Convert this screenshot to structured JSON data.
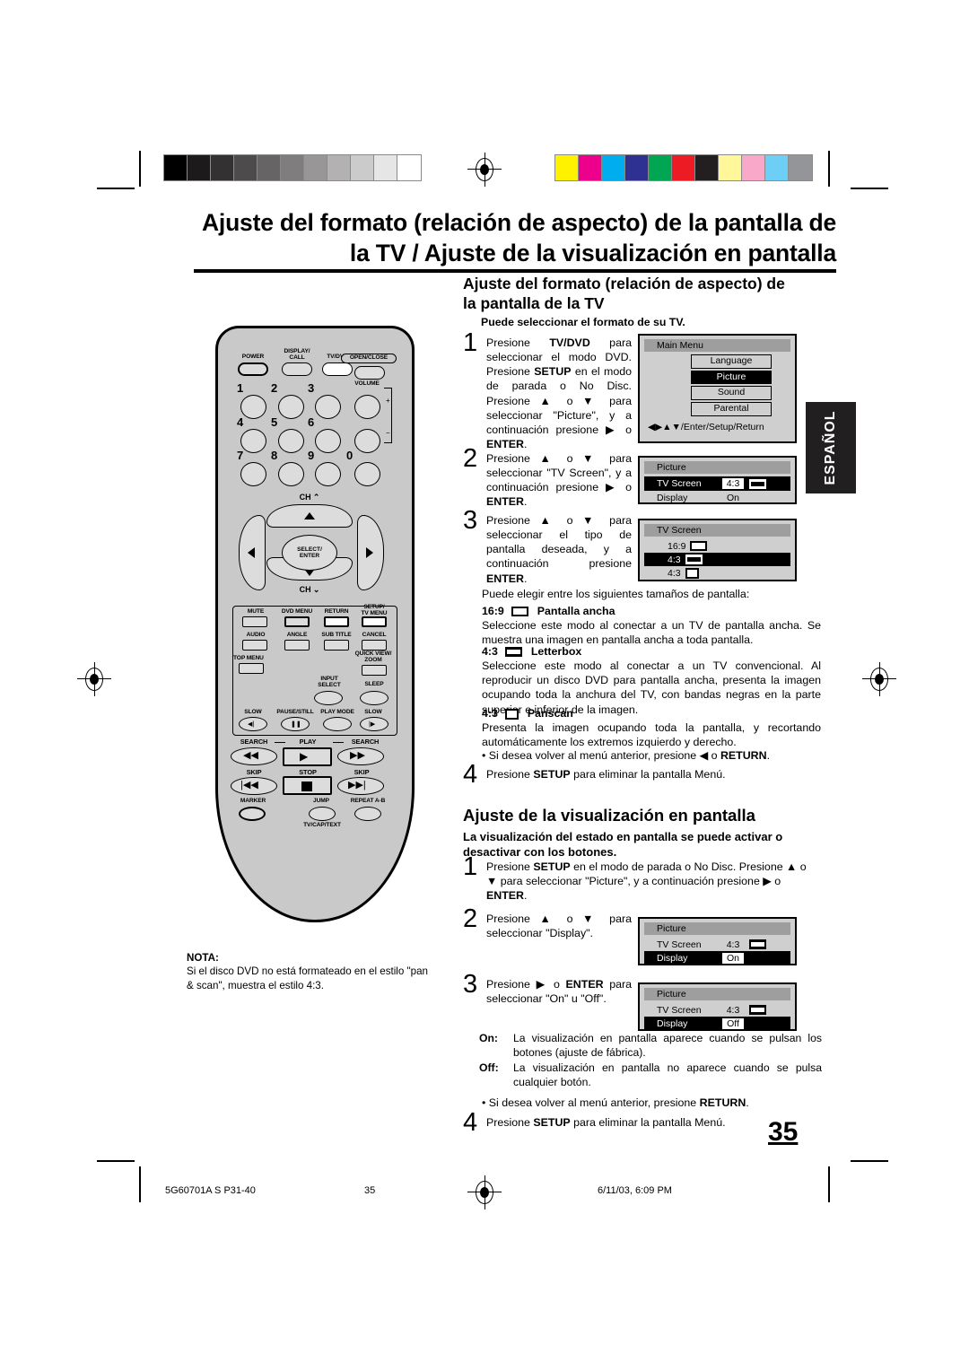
{
  "page": {
    "number": "35",
    "main_title_line1": "Ajuste del formato (relación de aspecto) de la pantalla de",
    "main_title_line2": "la TV / Ajuste de la visualización en pantalla",
    "language_tab": "ESPAÑOL"
  },
  "section1": {
    "title_line1": "Ajuste del formato (relación de aspecto) de",
    "title_line2": "la pantalla de la TV",
    "lead": "Puede seleccionar el formato de su TV.",
    "steps": [
      {
        "num": "1",
        "html": "Presione <b>TV/DVD</b> para seleccionar el modo DVD. Presione <b>SETUP</b> en el modo de parada o No Disc. Presione ▲ o ▼ para seleccionar \"Picture\", y a continuación presione ▶ o <b>ENTER</b>."
      },
      {
        "num": "2",
        "html": "Presione ▲ o ▼ para seleccionar \"TV Screen\", y a continuación presione ▶ o <b>ENTER</b>."
      },
      {
        "num": "3",
        "html": "Presione ▲ o ▼ para seleccionar el tipo de pantalla deseada, y a continuación presione <b>ENTER</b>."
      },
      {
        "num": "4",
        "html": "Presione <b>SETUP</b> para eliminar la pantalla Menú."
      }
    ],
    "sizes_intro": "Puede elegir entre los siguientes tamaños de pantalla:",
    "modes": [
      {
        "ratio": "16:9",
        "glyph": "widescreen-glyph",
        "name": "Pantalla ancha",
        "desc": "Seleccione este modo al conectar a un TV de pantalla ancha. Se muestra una imagen en pantalla ancha a toda pantalla."
      },
      {
        "ratio": "4:3",
        "glyph": "letterbox-glyph",
        "name": "Letterbox",
        "desc": "Seleccione este modo al conectar a un TV convencional. Al reproducir un disco DVD para pantalla ancha, presenta la imagen ocupando toda la anchura del TV, con bandas negras en la parte superior e inferior de la imagen."
      },
      {
        "ratio": "4:3",
        "glyph": "panscan-glyph",
        "name": "Panscan",
        "desc": "Presenta la imagen ocupando toda la pantalla, y recortando automáticamente los extremos izquierdo y derecho."
      }
    ],
    "return_note_html": "• Si desea volver al menú anterior, presione ◀ o <b>RETURN</b>."
  },
  "section2": {
    "title": "Ajuste de la visualización en pantalla",
    "lead": "La visualización del estado en pantalla se puede activar o desactivar con los botones.",
    "steps": [
      {
        "num": "1",
        "html": "Presione <b>SETUP</b> en el modo de parada o No Disc. Presione ▲ o ▼ para seleccionar \"Picture\", y a continuación presione ▶ o <b>ENTER</b>."
      },
      {
        "num": "2",
        "html": "Presione ▲ o ▼ para seleccionar \"Display\"."
      },
      {
        "num": "3",
        "html": "Presione ▶ o <b>ENTER</b> para seleccionar \"On\" u \"Off\"."
      },
      {
        "num": "4",
        "html": "Presione <b>SETUP</b> para eliminar la pantalla Menú."
      }
    ],
    "definitions": [
      {
        "key": "On:",
        "value": "La visualización en pantalla aparece cuando se pulsan los botones (ajuste de fábrica)."
      },
      {
        "key": "Off:",
        "value": "La visualización en pantalla no aparece cuando se pulsa cualquier botón."
      }
    ],
    "return_note_html": "• Si desea volver al menú anterior, presione <b>RETURN</b>."
  },
  "osd_screens": {
    "main_menu": {
      "title": "Main Menu",
      "items": [
        "Language",
        "Picture",
        "Sound",
        "Parental"
      ],
      "selected": "Picture",
      "hint": "◀▶▲▼/Enter/Setup/Return"
    },
    "picture_step2": {
      "title": "Picture",
      "rows": [
        {
          "label": "TV Screen",
          "value": "4:3",
          "glyph": "letterbox-glyph",
          "selected": true
        },
        {
          "label": "Display",
          "value": "On",
          "glyph": "",
          "selected": false
        }
      ]
    },
    "tv_screen_step3": {
      "title": "TV Screen",
      "rows": [
        {
          "label": "16:9",
          "glyph": "widescreen-glyph",
          "selected": false
        },
        {
          "label": "4:3",
          "glyph": "letterbox-glyph",
          "selected": true
        },
        {
          "label": "4:3",
          "glyph": "panscan-glyph",
          "selected": false
        }
      ]
    },
    "picture_display_on": {
      "title": "Picture",
      "rows": [
        {
          "label": "TV Screen",
          "value": "4:3",
          "glyph": "letterbox-glyph",
          "selected": false
        },
        {
          "label": "Display",
          "value": "On",
          "glyph": "",
          "selected": true
        }
      ]
    },
    "picture_display_off": {
      "title": "Picture",
      "rows": [
        {
          "label": "TV Screen",
          "value": "4:3",
          "glyph": "letterbox-glyph",
          "selected": false
        },
        {
          "label": "Display",
          "value": "Off",
          "glyph": "",
          "selected": true
        }
      ]
    }
  },
  "nota": {
    "heading": "NOTA:",
    "text": "Si el disco DVD no está formateado en el estilo \"pan & scan\", muestra el estilo 4:3."
  },
  "remote": {
    "labels": {
      "power": "POWER",
      "display_call": "DISPLAY/\nCALL",
      "tvdvd": "TV/DVD",
      "open_close": "OPEN/CLOSE",
      "volume": "VOLUME",
      "vol_plus": "+",
      "vol_minus": "−",
      "ch_up": "CH ⌃",
      "ch_down": "CH ⌄",
      "select_enter": "SELECT/\nENTER",
      "mute": "MUTE",
      "dvd_menu": "DVD MENU",
      "return": "RETURN",
      "setup_tv_menu": "SETUP/\nTV MENU",
      "audio": "AUDIO",
      "angle": "ANGLE",
      "sub_title": "SUB TITLE",
      "cancel": "CANCEL",
      "top_menu": "TOP MENU",
      "quick_view_zoom": "QUICK VIEW/\nZOOM",
      "input_select": "INPUT\nSELECT",
      "sleep": "SLEEP",
      "slow_left": "SLOW",
      "pause_still": "PAUSE/STILL",
      "play_mode": "PLAY MODE",
      "slow_right": "SLOW",
      "search_left": "SEARCH",
      "play": "PLAY",
      "search_right": "SEARCH",
      "skip_left": "SKIP",
      "stop": "STOP",
      "skip_right": "SKIP",
      "marker": "MARKER",
      "jump": "JUMP",
      "repeat_ab": "REPEAT A-B",
      "tv_cap_text": "TV/CAP/TEXT"
    },
    "numbers": [
      "1",
      "2",
      "3",
      "4",
      "5",
      "6",
      "7",
      "8",
      "9",
      "0"
    ]
  },
  "footer": {
    "doc_id": "5G60701A S P31-40",
    "page": "35",
    "timestamp": "6/11/03, 6:09 PM"
  },
  "colors": {
    "gray_bars": [
      "#000000",
      "#1c1a1b",
      "#333132",
      "#4d4b4c",
      "#676465",
      "#7f7d7e",
      "#999697",
      "#b3b1b2",
      "#cccbcb",
      "#e6e6e6",
      "#ffffff"
    ],
    "color_bars": [
      "#fff200",
      "#ec008c",
      "#00aeef",
      "#2e3192",
      "#00a651",
      "#ed1c24",
      "#231f20",
      "#fff79a",
      "#f9a8c9",
      "#6dcff6",
      "#939598"
    ],
    "osd_bg": "#cfcfcf",
    "osd_title_bg": "#9e9e9e",
    "remote_body": "#c9c9c9"
  }
}
